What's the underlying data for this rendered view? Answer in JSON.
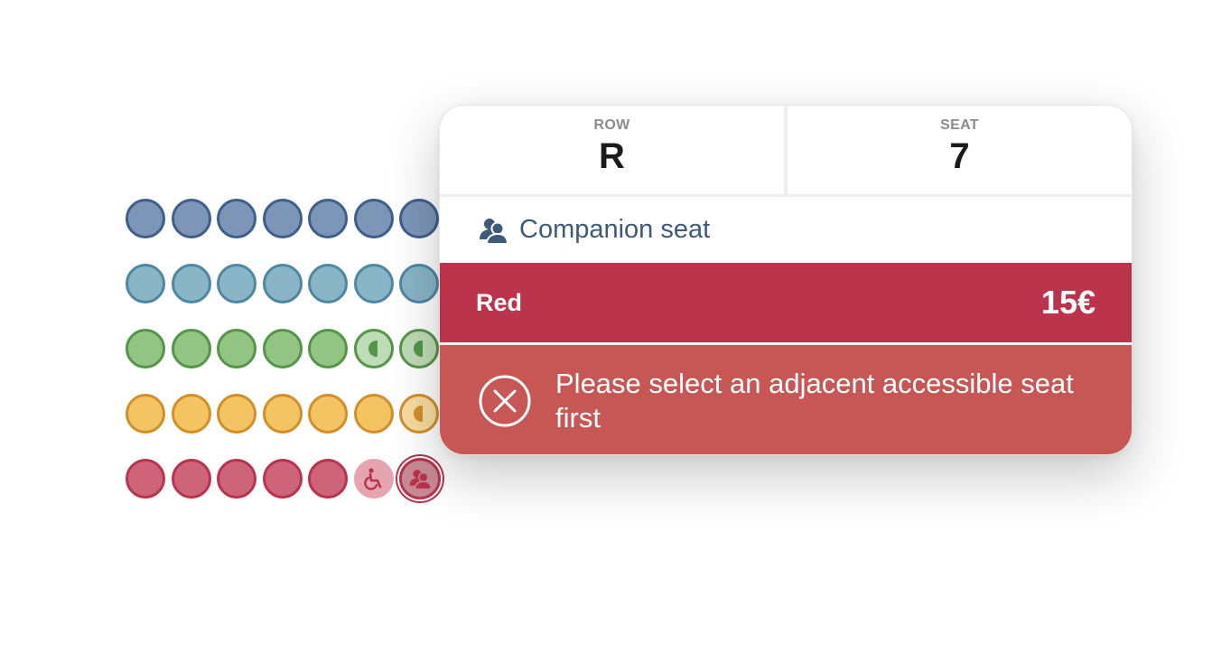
{
  "colors": {
    "blue": {
      "fill": "#7d96b8",
      "border": "#3f5f8b"
    },
    "lightblue": {
      "fill": "#89b5c7",
      "border": "#4e87a1"
    },
    "green": {
      "fill": "#92c583",
      "border": "#55954a"
    },
    "yellow": {
      "fill": "#f4c462",
      "border": "#d08f2a"
    },
    "red": {
      "fill": "#ce6479",
      "border": "#b8334b"
    }
  },
  "seatmap": {
    "rows": [
      {
        "color": "blue",
        "seats": [
          "available",
          "available",
          "available",
          "available",
          "available",
          "available",
          "available"
        ]
      },
      {
        "color": "lightblue",
        "seats": [
          "available",
          "available",
          "available",
          "available",
          "available",
          "available",
          "available"
        ]
      },
      {
        "color": "green",
        "seats": [
          "available",
          "available",
          "available",
          "available",
          "available",
          "partial",
          "partial"
        ]
      },
      {
        "color": "yellow",
        "seats": [
          "available",
          "available",
          "available",
          "available",
          "available",
          "available",
          "partial"
        ]
      },
      {
        "color": "red",
        "seats": [
          "available",
          "available",
          "available",
          "available",
          "available",
          "wheelchair",
          "companion-selected"
        ]
      }
    ]
  },
  "popup": {
    "row_label": "ROW",
    "row_value": "R",
    "seat_label": "SEAT",
    "seat_value": "7",
    "seat_type": "Companion seat",
    "seat_type_icon": "companion-icon",
    "category": "Red",
    "price": "15€",
    "category_color": "#bb344c",
    "error_icon": "close-circle-icon",
    "error_message": "Please select an adjacent accessible seat first",
    "error_color": "#c65754"
  }
}
